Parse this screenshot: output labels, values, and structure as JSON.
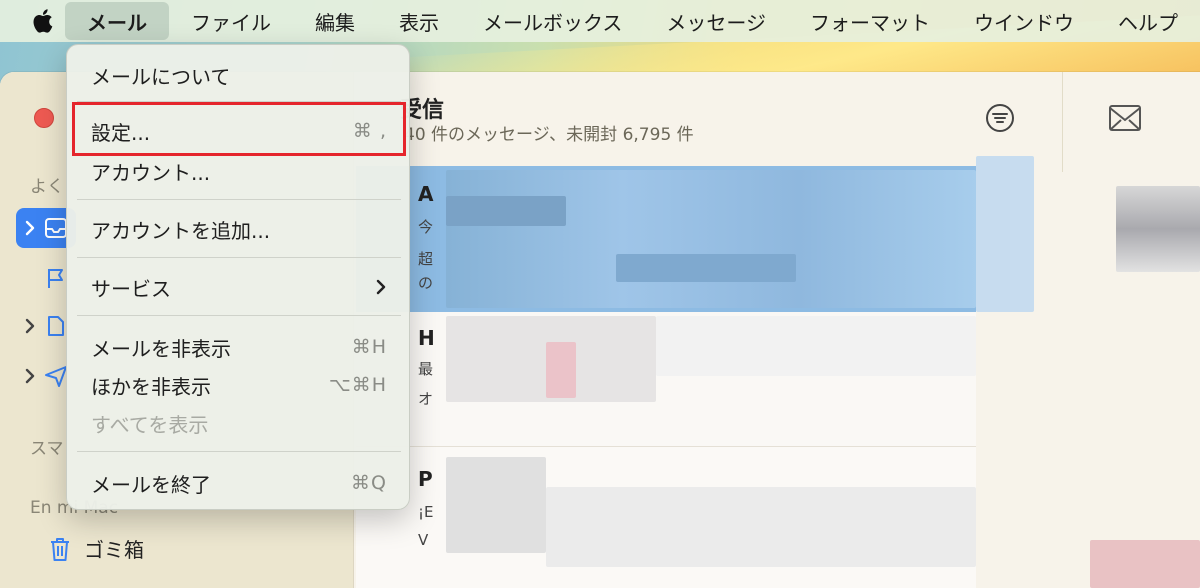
{
  "menubar": {
    "items": [
      "メール",
      "ファイル",
      "編集",
      "表示",
      "メールボックス",
      "メッセージ",
      "フォーマット",
      "ウインドウ",
      "ヘルプ"
    ],
    "active_index": 0
  },
  "dropdown": {
    "about": "メールについて",
    "settings": "設定...",
    "settings_shortcut": "⌘ ,",
    "accounts": "アカウント...",
    "add_account": "アカウントを追加...",
    "services": "サービス",
    "hide_mail": "メールを非表示",
    "hide_mail_shortcut": "⌘H",
    "hide_others": "ほかを非表示",
    "hide_others_shortcut": "⌥⌘H",
    "show_all": "すべてを表示",
    "quit": "メールを終了",
    "quit_shortcut": "⌘Q"
  },
  "sidebar": {
    "favorites_label": "よく",
    "smart_label": "スマ",
    "on_my_mac_label": "En mi Mac",
    "trash_label": "ゴミ箱"
  },
  "list": {
    "title": "受信",
    "subtitle": "40 件のメッセージ、未開封 6,795 件",
    "messages": [
      {
        "letter": "A",
        "line1": "今",
        "line2": "超",
        "line3": "の"
      },
      {
        "letter": "H",
        "line1": "最",
        "line2": "オ"
      },
      {
        "letter": "P",
        "line1": "¡E",
        "line2": "V"
      }
    ]
  },
  "colors": {
    "accent": "#3b82f2",
    "highlight": "#e5252c",
    "selected_row": "#8dbbe3"
  }
}
